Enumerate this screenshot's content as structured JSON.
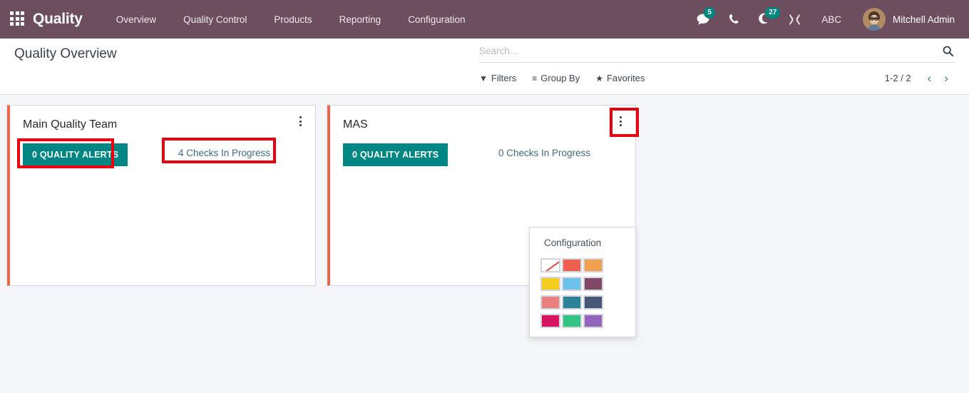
{
  "navbar": {
    "apps_icon": "apps-grid-icon",
    "brand": "Quality",
    "menu": [
      {
        "label": "Overview"
      },
      {
        "label": "Quality Control"
      },
      {
        "label": "Products"
      },
      {
        "label": "Reporting"
      },
      {
        "label": "Configuration"
      }
    ],
    "messages_icon": "messages-icon",
    "messages_badge": "5",
    "phone_icon": "phone-icon",
    "activities_icon": "activities-clock-icon",
    "activities_badge": "27",
    "debug_icon": "wrench-tools-icon",
    "company": "ABC",
    "avatar": "user-avatar",
    "user_name": "Mitchell Admin",
    "background": "#6d4e5e",
    "badge_color": "#00857f"
  },
  "control_panel": {
    "title": "Quality Overview",
    "search": {
      "placeholder": "Search...",
      "value": "",
      "icon": "search-icon"
    },
    "buttons": [
      {
        "label": "Filters",
        "glyph": "▼",
        "icon": "filter-icon"
      },
      {
        "label": "Group By",
        "glyph": "≡",
        "icon": "group-by-icon"
      },
      {
        "label": "Favorites",
        "glyph": "★",
        "icon": "star-icon"
      }
    ],
    "pager": {
      "count": "1-2 / 2",
      "previous": "‹",
      "next": "›"
    }
  },
  "kanban": {
    "card_accent": "#ef6549",
    "alert_button_color": "#008784",
    "cards": [
      {
        "title": "Main Quality Team",
        "alerts_label": "0 QUALITY ALERTS",
        "checks_label": "4 Checks In Progress",
        "manage_icon": "vertical-dots-icon"
      },
      {
        "title": "MAS",
        "alerts_label": "0 QUALITY ALERTS",
        "checks_label": "0 Checks In Progress",
        "manage_icon": "vertical-dots-icon"
      }
    ]
  },
  "dropdown": {
    "header": "Configuration",
    "colors": [
      {
        "name": "No color",
        "hex": "#ffffff"
      },
      {
        "name": "Red",
        "hex": "#f06050"
      },
      {
        "name": "Orange",
        "hex": "#f0a04f"
      },
      {
        "name": "Yellow",
        "hex": "#f4cd1f"
      },
      {
        "name": "Light blue",
        "hex": "#6cc1ed"
      },
      {
        "name": "Dark purple",
        "hex": "#814968"
      },
      {
        "name": "Salmon pink",
        "hex": "#eb7e7f"
      },
      {
        "name": "Medium blue",
        "hex": "#2c8397"
      },
      {
        "name": "Dark blue",
        "hex": "#475577"
      },
      {
        "name": "Fuchsia",
        "hex": "#d6145f"
      },
      {
        "name": "Green",
        "hex": "#30c381"
      },
      {
        "name": "Purple",
        "hex": "#9365b8"
      }
    ]
  },
  "annotations": {
    "color": "#e9000e",
    "boxes": [
      {
        "name": "quality-alerts-highlight"
      },
      {
        "name": "checks-in-progress-highlight"
      },
      {
        "name": "manage-menu-highlight"
      }
    ]
  }
}
